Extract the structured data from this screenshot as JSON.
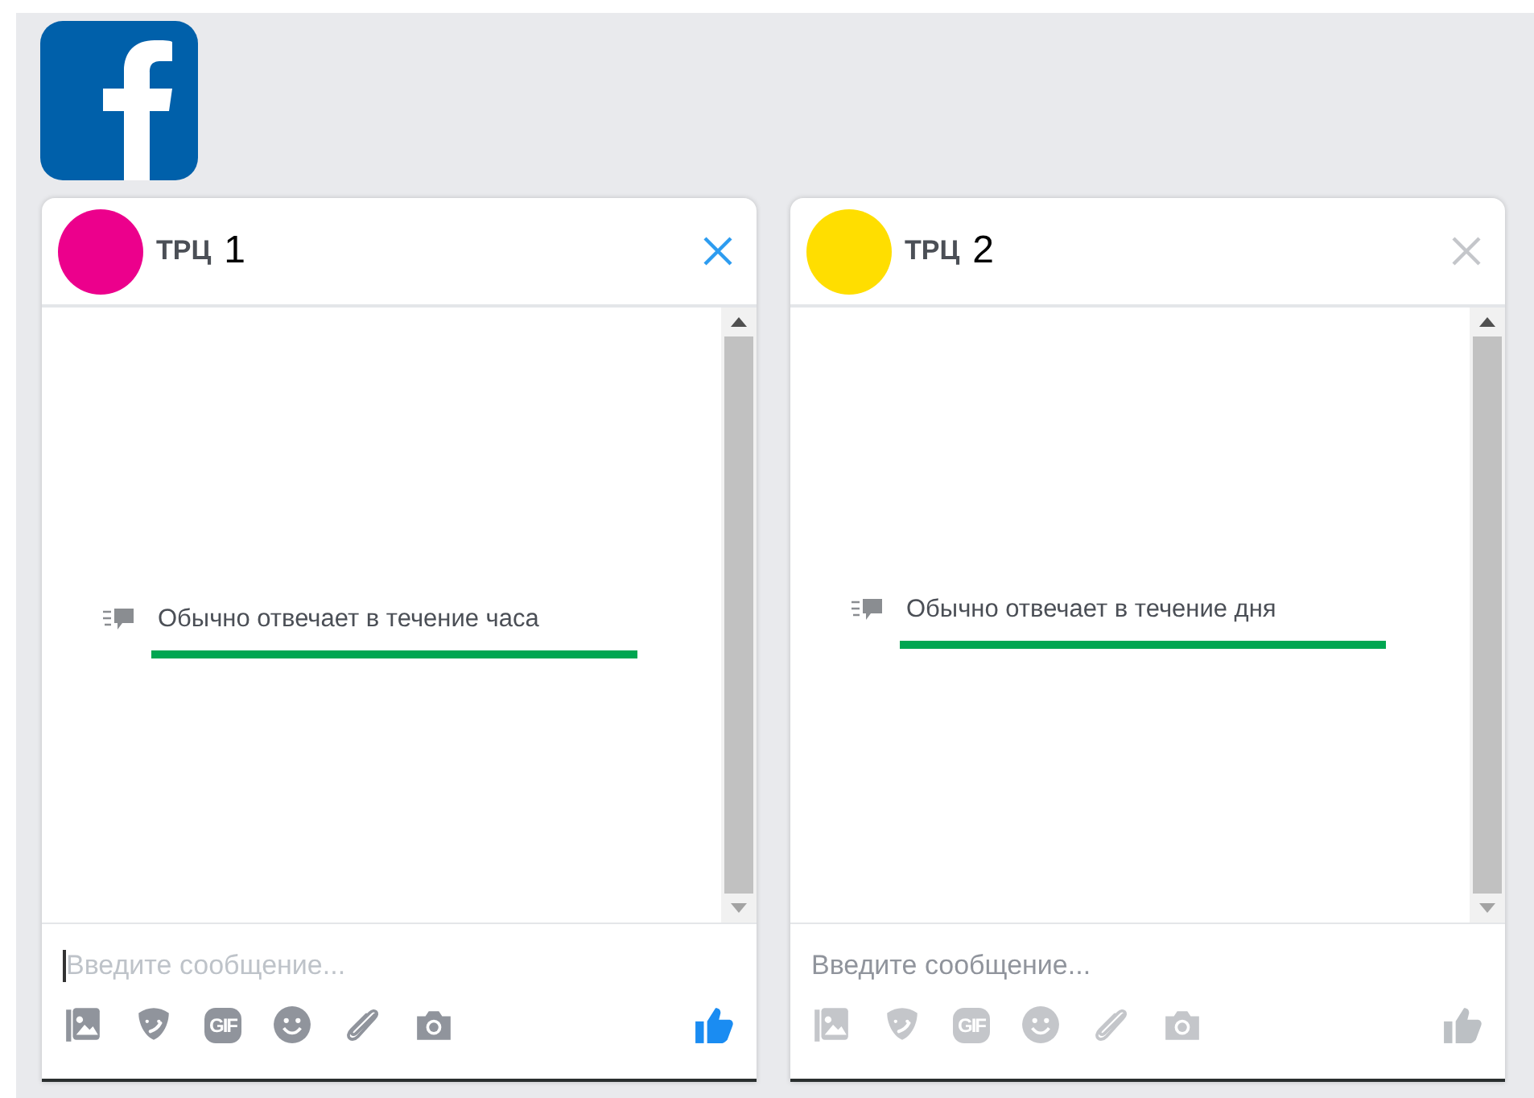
{
  "chats": [
    {
      "name": "ТРЦ",
      "number": "1",
      "color": "#ec008c",
      "active": true,
      "response_note": "Обычно отвечает в течение часа",
      "placeholder": "Введите сообщение...",
      "gif_label": "GIF"
    },
    {
      "name": "ТРЦ",
      "number": "2",
      "color": "#ffde00",
      "active": false,
      "response_note": "Обычно отвечает в течение дня",
      "placeholder": "Введите сообщение...",
      "gif_label": "GIF"
    }
  ]
}
